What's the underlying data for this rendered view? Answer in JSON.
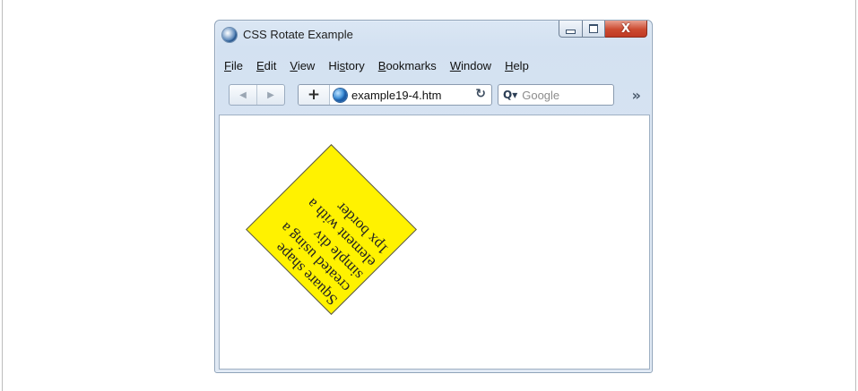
{
  "window": {
    "title": "CSS Rotate Example",
    "close_glyph": "X"
  },
  "menu": [
    {
      "u": "F",
      "rest": "ile"
    },
    {
      "u": "E",
      "rest": "dit"
    },
    {
      "u": "V",
      "rest": "iew"
    },
    {
      "pre": "Hi",
      "u": "s",
      "rest": "tory"
    },
    {
      "u": "B",
      "rest": "ookmarks"
    },
    {
      "u": "W",
      "rest": "indow"
    },
    {
      "u": "H",
      "rest": "elp"
    }
  ],
  "toolbar": {
    "back_glyph": "◀",
    "forward_glyph": "▶",
    "add_glyph": "+",
    "url": "example19-4.htm",
    "reload_glyph": "↻",
    "search_glyph": "Q▾",
    "search_placeholder": "Google",
    "overflow_glyph": "»"
  },
  "content": {
    "square_text": "Square shape created using a simple div element with a 1px border"
  },
  "colors": {
    "square_fill": "#fff200",
    "close_button": "#cc4a30"
  },
  "icons": [
    "browser-app-icon",
    "minimize-icon",
    "maximize-icon",
    "close-icon",
    "back-arrow-icon",
    "forward-arrow-icon",
    "plus-icon",
    "globe-icon",
    "reload-icon",
    "search-icon",
    "chevron-overflow-icon"
  ]
}
